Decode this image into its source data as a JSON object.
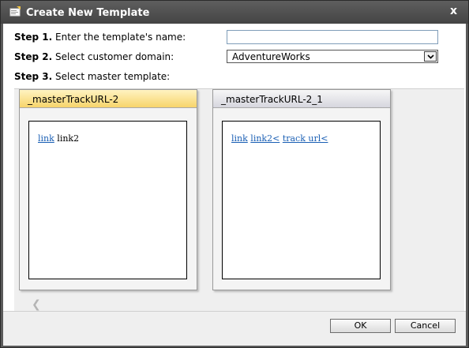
{
  "dialog": {
    "title": "Create New Template",
    "close_label": "x"
  },
  "steps": {
    "step1_prefix": "Step 1.",
    "step1_text": "Enter the template's name:",
    "step2_prefix": "Step 2.",
    "step2_text": "Select customer domain:",
    "step3_prefix": "Step 3.",
    "step3_text": "Select master template:"
  },
  "name_input": {
    "value": ""
  },
  "domain_select": {
    "value": "AdventureWorks"
  },
  "templates": [
    {
      "name": "_masterTrackURL-2",
      "selected": true,
      "preview": [
        {
          "text": "link",
          "is_link": true
        },
        {
          "text": "link2",
          "is_link": false
        }
      ]
    },
    {
      "name": "_masterTrackURL-2_1",
      "selected": false,
      "preview": [
        {
          "text": "link",
          "is_link": true
        },
        {
          "text": "link2<",
          "is_link": true
        },
        {
          "text": "track url<",
          "is_link": true
        }
      ]
    }
  ],
  "buttons": {
    "ok": "OK",
    "cancel": "Cancel"
  }
}
